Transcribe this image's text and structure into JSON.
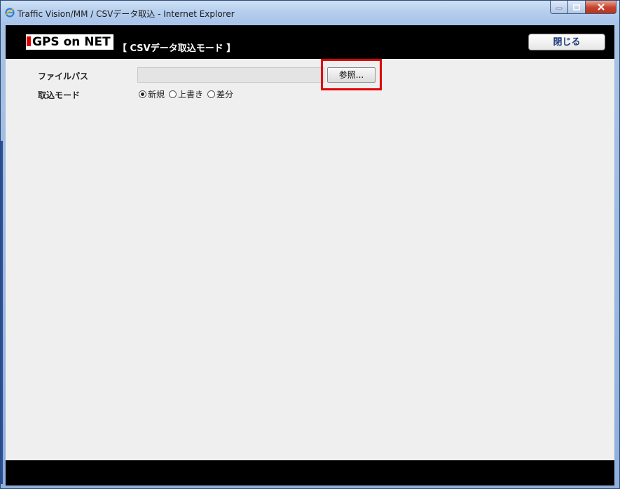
{
  "window": {
    "title": "Traffic Vision/MM / CSVデータ取込 - Internet Explorer"
  },
  "header": {
    "logo_text": "GPS on NET",
    "title": "【 CSVデータ取込モード 】",
    "close_label": "閉じる"
  },
  "form": {
    "file_path_label": "ファイルパス",
    "file_path_value": "",
    "browse_label": "参照...",
    "mode_label": "取込モード",
    "mode_options": [
      {
        "label": "新規",
        "selected": true
      },
      {
        "label": "上書き",
        "selected": false
      },
      {
        "label": "差分",
        "selected": false
      }
    ]
  },
  "colors": {
    "highlight": "#e00000",
    "header_bg": "#000000",
    "client_bg": "#efefef"
  }
}
